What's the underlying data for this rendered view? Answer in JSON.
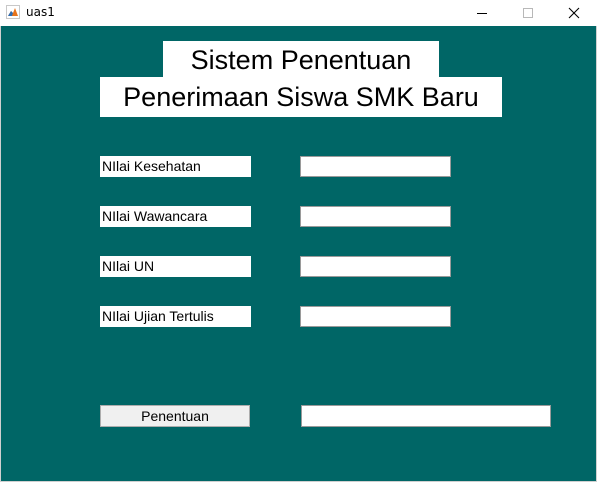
{
  "window": {
    "title": "uas1",
    "icon": "matlab-icon",
    "controls": [
      "minimize-icon",
      "maximize-icon",
      "close-icon"
    ]
  },
  "heading": {
    "line1": "Sistem Penentuan",
    "line2": "Penerimaan Siswa SMK Baru"
  },
  "fields": [
    {
      "label": "NIlai Kesehatan",
      "value": ""
    },
    {
      "label": "NIlai Wawancara",
      "value": ""
    },
    {
      "label": "NIlai UN",
      "value": ""
    },
    {
      "label": "NIlai Ujian Tertulis",
      "value": ""
    }
  ],
  "action": {
    "button_label": "Penentuan",
    "result_value": ""
  },
  "colors": {
    "background": "#006666",
    "panel": "#ffffff"
  }
}
